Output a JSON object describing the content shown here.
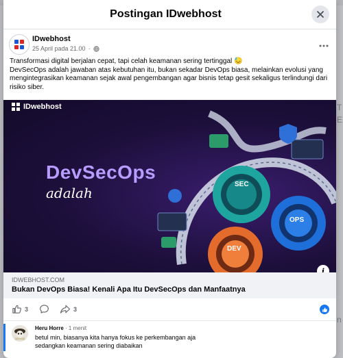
{
  "modal": {
    "title": "Postingan IDwebhost"
  },
  "post": {
    "page_name": "IDwebhost",
    "date": "25 April pada 21.00",
    "privacy_separator": "·",
    "text_lines": [
      "Transformasi digital berjalan cepat, tapi celah keamanan sering tertinggal 😓",
      "DevSecOps adalah jawaban atas kebutuhan itu, bukan sekadar DevOps biasa, melainkan evolusi yang mengintegrasikan keamanan sejak awal pengembangan agar bisnis tetap gesit sekaligus terlindungi dari risiko siber."
    ],
    "image": {
      "logo_text": "IDwebhost",
      "headline": "DevSecOps",
      "subline": "adalah",
      "gear_labels": [
        "SEC",
        "OPS",
        "DEV"
      ]
    },
    "link": {
      "domain": "IDWEBHOST.COM",
      "title": "Bukan DevOps Biasa! Kenali Apa Itu DevSecOps dan Manfaatnya"
    },
    "reactions": {
      "likes": "3",
      "shares": "3"
    }
  },
  "comment": {
    "author": "Heru Horre",
    "time": "· 1 menit",
    "lines": [
      "betul min, biasanya kita hanya fokus ke perkembangan aja",
      "sedangkan keamanan sering diabaikan"
    ]
  },
  "background": {
    "side_text_1": "T",
    "side_text_2": "E",
    "side_text_3": "n"
  },
  "colors": {
    "accent": "#1877f2",
    "headline": "#b99cff",
    "image_bg": "#1c0f3a"
  },
  "icons": [
    "close-icon",
    "globe-icon",
    "more-icon",
    "like-icon",
    "comment-icon",
    "share-icon",
    "info-icon"
  ]
}
